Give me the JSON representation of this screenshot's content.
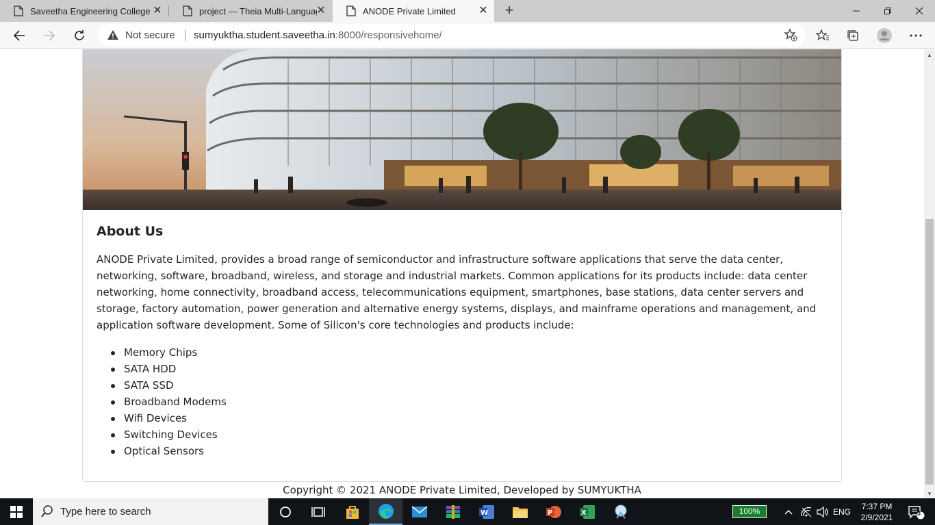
{
  "browser": {
    "tabs": [
      {
        "title": "Saveetha Engineering College"
      },
      {
        "title": "project — Theia Multi-Language"
      },
      {
        "title": "ANODE Private Limited"
      }
    ],
    "address": {
      "security_label": "Not secure",
      "url_host": "sumyuktha.student.saveetha.in",
      "url_rest": ":8000/responsivehome/"
    }
  },
  "page": {
    "about_title": "About Us",
    "about_text": "ANODE Private Limited, provides a broad range of semiconductor and infrastructure software applications that serve the data center, networking, software, broadband, wireless, and storage and industrial markets. Common applications for its products include: data center networking, home connectivity, broadband access, telecommunications equipment, smartphones, base stations, data center servers and storage, factory automation, power generation and alternative energy systems, displays, and mainframe operations and management, and application software development. Some of Silicon's core technologies and products include:",
    "products": [
      "Memory Chips",
      "SATA HDD",
      "SATA SSD",
      "Broadband Modems",
      "Wifi Devices",
      "Switching Devices",
      "Optical Sensors"
    ],
    "footer": "Copyright © 2021 ANODE Private Limited, Developed by SUMYUKTHA"
  },
  "taskbar": {
    "search_placeholder": "Type here to search",
    "battery": "100%",
    "language": "ENG",
    "time": "7:37 PM",
    "date": "2/9/2021",
    "notifications": "3"
  }
}
